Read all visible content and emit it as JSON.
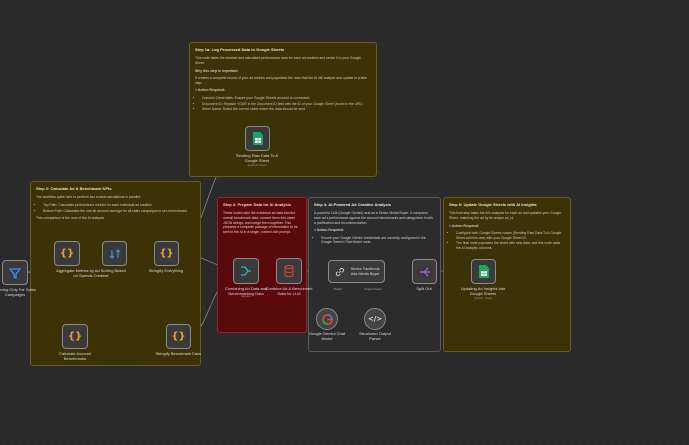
{
  "notes": {
    "step1": {
      "title": "Step 1a: Log Processed Data to Google Sheets",
      "p1": "This node takes the cleaned and calculated performance data for each ad creative and sends it to your Google Sheet.",
      "why_title": "Why this step is important:",
      "why_text": "It creates a complete record of your ad metrics and populates the rows that the AI will analyze and update in a later step.",
      "action_title": "Action Required:",
      "items": [
        "Connect Credentials: Ensure your Google Sheets account is connected.",
        "Document ID: Replace YOUR in the Document ID field with the ID of your Google Sheet (found in the URL).",
        "Sheet Name: Select the correct sheet where the data should be sent."
      ]
    },
    "step2": {
      "title": "Step 2: Calculate Ad & Benchmark KPIs",
      "p1": "The workflow splits here to perform two crucial calculations in parallel:",
      "items": [
        "Top Path: Calculates performance metrics for each individual ad creative.",
        "Bottom Path: Calculates the overall account average for all sales campaigns to set a benchmark."
      ],
      "p2": "This comparison is the core of the AI analysis."
    },
    "step3": {
      "title": "Step 3: Prepare Data for AI Analysis",
      "p1": "These nodes take the individual ad data and the overall benchmark data, convert them into clean JSON strings, and merge them together. This prepares a complete package of information to be sent to the AI in a single, context-rich prompt."
    },
    "step4": {
      "title": "Step 4: AI-Powered Ad Creative Analysis",
      "p1": "A powerful LLM (Google Gemini) acts as a Senior Media Buyer. It compares each ad's performance against the account benchmarks and categorizes it with a justification and recommendation.",
      "action_title": "Action Required:",
      "items": [
        "Ensure your Google Gemini credentials are correctly configured in the Google Gemini Chat Model node."
      ]
    },
    "step5": {
      "title": "Step 5: Update Google Sheets with AI Insights",
      "p1": "This final step takes the AI's analysis for each ad and updates your Google Sheet, matching the ad by its unique ad_id.",
      "action_title": "Action Required:",
      "items": [
        "Configure both Google Sheets nodes (Sending Raw Data To A Google Sheet and this one) with your Google Sheet ID.",
        "The final node populates the sheet with new data, and this node adds the AI analysis columns."
      ]
    }
  },
  "nodes": {
    "filter": {
      "label": "Filtering Only For Sales Campaigns",
      "icon": "funnel-icon"
    },
    "aggregate": {
      "label": "Aggregate Metrics by Ad Sorting Based on Spends Creative",
      "icon": "code-icon"
    },
    "sort": {
      "label": "",
      "icon": "sort-icon"
    },
    "stringify_all": {
      "label": "Stringify Everything",
      "icon": "code-icon"
    },
    "calc_bench": {
      "label": "Calculate Account Benchmarks",
      "icon": "code-icon"
    },
    "stringify_bench": {
      "label": "Stringify Benchmark Data",
      "icon": "code-icon"
    },
    "combine": {
      "label": "Combining Ad Data and Benchmarking Data",
      "sub": "append",
      "icon": "merge-icon"
    },
    "combine_llm": {
      "label": "Combine Ad & Benchmark Data for LLM",
      "icon": "database-icon"
    },
    "media_buyer": {
      "label": "Senior Facebook Ads Media Buyer",
      "icon": "link-icon",
      "port_left": "Model*",
      "port_right": "Output Parser"
    },
    "gemini": {
      "label": "Google Gemini Chat Model",
      "icon": "gemini-icon"
    },
    "parser": {
      "label": "Structured Output Parser",
      "icon": "brackets-icon"
    },
    "split": {
      "label": "Split Out",
      "icon": "split-icon"
    },
    "update_sheet": {
      "label": "Updating Ad Insights Into Google Sheets",
      "sub": "update: sheet",
      "icon": "sheets-icon"
    },
    "send_raw": {
      "label": "Sending Raw Data To A Google Sheet",
      "sub": "append: sheet",
      "icon": "sheets-icon"
    }
  },
  "colors": {
    "sheets_green": "#1fa463",
    "code_orange": "#f0a030",
    "merge_teal": "#2fb5c8",
    "db_red": "#e04040",
    "split_purple": "#b060e0",
    "filter_blue": "#3b8ff0",
    "gemini_red": "#ea4335",
    "wire": "#8a8a8a"
  }
}
